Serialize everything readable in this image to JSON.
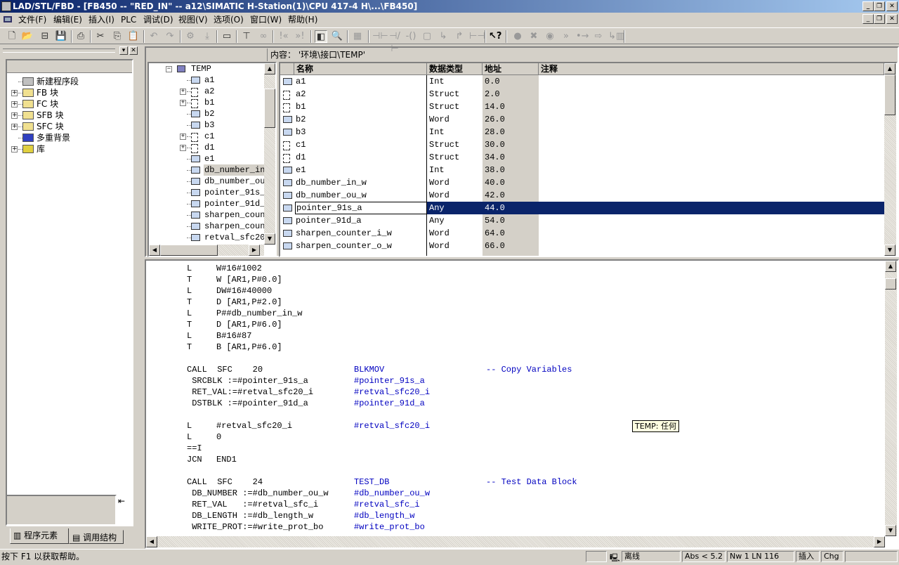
{
  "window": {
    "title": "LAD/STL/FBD  - [FB450 -- \"RED_IN\" -- a12\\SIMATIC H-Station(1)\\CPU 417-4 H\\...\\FB450]"
  },
  "menu": [
    "文件(F)",
    "编辑(E)",
    "插入(I)",
    "PLC",
    "调试(D)",
    "视图(V)",
    "选项(O)",
    "窗口(W)",
    "帮助(H)"
  ],
  "toolbar_icons": [
    "new-icon",
    "open-icon",
    "accessible-nodes-icon",
    "save-icon",
    "print-icon",
    "cut-icon",
    "copy-icon",
    "paste-icon",
    "undo-icon",
    "redo-icon",
    "compile-icon",
    "download-icon",
    "overview-icon",
    "network-icon",
    "monitor-icon",
    "prev-error-icon",
    "next-error-icon",
    "program-elements-icon",
    "details-icon",
    "new-network-icon",
    "normally-open-icon",
    "normally-closed-icon",
    "coil-icon",
    "empty-box-icon",
    "open-branch-icon",
    "close-branch-icon",
    "connection-icon",
    "help-icon",
    "breakpoint-icon",
    "delete-breakpoint-icon",
    "breakpoint-active-icon",
    "next-statement-icon",
    "step-icon",
    "step-out-icon",
    "call-icon"
  ],
  "left_panel": {
    "items": [
      {
        "label": "新建程序段",
        "expandable": false,
        "icon": "new-network-icon"
      },
      {
        "label": "FB 块",
        "expandable": true,
        "icon": "folder-icon"
      },
      {
        "label": "FC 块",
        "expandable": true,
        "icon": "folder-icon"
      },
      {
        "label": "SFB 块",
        "expandable": true,
        "icon": "folder-icon"
      },
      {
        "label": "SFC 块",
        "expandable": true,
        "icon": "folder-icon"
      },
      {
        "label": "多重背景",
        "expandable": false,
        "icon": "multi-instance-icon"
      },
      {
        "label": "库",
        "expandable": true,
        "icon": "library-icon"
      }
    ],
    "tabs": [
      "程序元素",
      "调用结构"
    ]
  },
  "interface": {
    "content_label": "内容：  '环境\\接口\\TEMP'",
    "tree_root": "TEMP",
    "tree_items": [
      {
        "label": "a1",
        "struct": false
      },
      {
        "label": "a2",
        "struct": true
      },
      {
        "label": "b1",
        "struct": true
      },
      {
        "label": "b2",
        "struct": false
      },
      {
        "label": "b3",
        "struct": false
      },
      {
        "label": "c1",
        "struct": true
      },
      {
        "label": "d1",
        "struct": true
      },
      {
        "label": "e1",
        "struct": false
      },
      {
        "label": "db_number_in_",
        "struct": false,
        "selected": true
      },
      {
        "label": "db_number_ou_",
        "struct": false
      },
      {
        "label": "pointer_91s_",
        "struct": false
      },
      {
        "label": "pointer_91d_",
        "struct": false
      },
      {
        "label": "sharpen_coun",
        "struct": false
      },
      {
        "label": "sharpen_coun",
        "struct": false
      },
      {
        "label": "retval_sfc20_",
        "struct": false
      }
    ],
    "columns": [
      "名称",
      "数据类型",
      "地址",
      "注释"
    ],
    "rows": [
      {
        "name": "a1",
        "type": "Int",
        "address": "0.0",
        "struct": false
      },
      {
        "name": "a2",
        "type": "Struct",
        "address": "2.0",
        "struct": true
      },
      {
        "name": "b1",
        "type": "Struct",
        "address": "14.0",
        "struct": true
      },
      {
        "name": "b2",
        "type": "Word",
        "address": "26.0",
        "struct": false
      },
      {
        "name": "b3",
        "type": "Int",
        "address": "28.0",
        "struct": false
      },
      {
        "name": "c1",
        "type": "Struct",
        "address": "30.0",
        "struct": true
      },
      {
        "name": "d1",
        "type": "Struct",
        "address": "34.0",
        "struct": true
      },
      {
        "name": "e1",
        "type": "Int",
        "address": "38.0",
        "struct": false
      },
      {
        "name": "db_number_in_w",
        "type": "Word",
        "address": "40.0",
        "struct": false
      },
      {
        "name": "db_number_ou_w",
        "type": "Word",
        "address": "42.0",
        "struct": false
      },
      {
        "name": "pointer_91s_a",
        "type": "Any",
        "address": "44.0",
        "struct": false,
        "selected": true
      },
      {
        "name": "pointer_91d_a",
        "type": "Any",
        "address": "54.0",
        "struct": false
      },
      {
        "name": "sharpen_counter_i_w",
        "type": "Word",
        "address": "64.0",
        "struct": false
      },
      {
        "name": "sharpen_counter_o_w",
        "type": "Word",
        "address": "66.0",
        "struct": false
      }
    ]
  },
  "code": [
    {
      "op": "L",
      "arg": "W#16#1002"
    },
    {
      "op": "T",
      "arg": "W [AR1,P#0.0]"
    },
    {
      "op": "L",
      "arg": "DW#16#40000"
    },
    {
      "op": "T",
      "arg": "D [AR1,P#2.0]"
    },
    {
      "op": "L",
      "arg": "P##db_number_in_w"
    },
    {
      "op": "T",
      "arg": "D [AR1,P#6.0]"
    },
    {
      "op": "L",
      "arg": "B#16#87"
    },
    {
      "op": "T",
      "arg": "B [AR1,P#6.0]"
    },
    {},
    {
      "op": "CALL  SFC    20",
      "sym": "BLKMOV",
      "cmt": "-- Copy Variables"
    },
    {
      "op": " SRCBLK :=#pointer_91s_a",
      "sym": "#pointer_91s_a"
    },
    {
      "op": " RET_VAL:=#retval_sfc20_i",
      "sym": "#retval_sfc20_i"
    },
    {
      "op": " DSTBLK :=#pointer_91d_a",
      "sym": "#pointer_91d_a"
    },
    {},
    {
      "op": "L",
      "arg": "#retval_sfc20_i",
      "sym": "#retval_sfc20_i"
    },
    {
      "op": "L",
      "arg": "0"
    },
    {
      "op": "==I"
    },
    {
      "op": "JCN",
      "arg": "END1"
    },
    {},
    {
      "op": "CALL  SFC    24",
      "sym": "TEST_DB",
      "cmt": "-- Test Data Block"
    },
    {
      "op": " DB_NUMBER :=#db_number_ou_w",
      "sym": "#db_number_ou_w"
    },
    {
      "op": " RET_VAL   :=#retval_sfc_i",
      "sym": "#retval_sfc_i"
    },
    {
      "op": " DB_LENGTH :=#db_length_w",
      "sym": "#db_length_w"
    },
    {
      "op": " WRITE_PROT:=#write_prot_bo",
      "sym": "#write_prot_bo"
    }
  ],
  "tooltip": "TEMP: 任何",
  "status": {
    "help": "按下 F1 以获取帮助。",
    "online": "离线",
    "abs": "Abs < 5.2",
    "position": "Nw 1  LN 116",
    "mode": "插入",
    "chg": "Chg"
  },
  "colors": {
    "title_start": "#0a246a",
    "title_end": "#a6caf0",
    "selection": "#0a246a",
    "symbol_text": "#0000c0"
  }
}
